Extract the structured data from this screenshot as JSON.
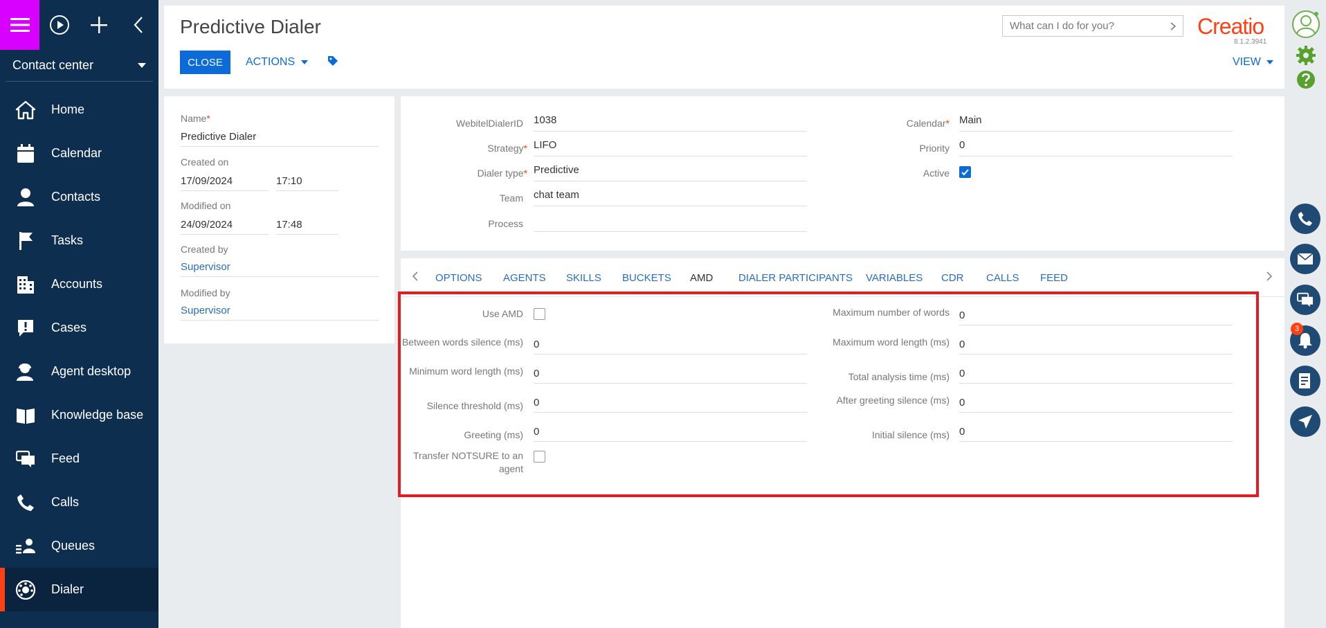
{
  "sidebar": {
    "workspace": "Contact center",
    "items": [
      {
        "label": "Home",
        "icon": "home-icon"
      },
      {
        "label": "Calendar",
        "icon": "calendar-icon"
      },
      {
        "label": "Contacts",
        "icon": "contact-icon"
      },
      {
        "label": "Tasks",
        "icon": "flag-icon"
      },
      {
        "label": "Accounts",
        "icon": "building-icon"
      },
      {
        "label": "Cases",
        "icon": "case-icon"
      },
      {
        "label": "Agent desktop",
        "icon": "agent-icon"
      },
      {
        "label": "Knowledge base",
        "icon": "book-icon"
      },
      {
        "label": "Feed",
        "icon": "chat-icon"
      },
      {
        "label": "Calls",
        "icon": "phone-icon"
      },
      {
        "label": "Queues",
        "icon": "queue-icon"
      },
      {
        "label": "Dialer",
        "icon": "dialer-icon",
        "active": true
      }
    ]
  },
  "header": {
    "title": "Predictive Dialer",
    "close_label": "CLOSE",
    "actions_label": "ACTIONS",
    "search_placeholder": "What can I do for you?",
    "logo": "Creatio",
    "version": "8.1.2.3941",
    "view_label": "VIEW"
  },
  "info": {
    "name_label": "Name",
    "name_value": "Predictive Dialer",
    "created_on_label": "Created on",
    "created_date": "17/09/2024",
    "created_time": "17:10",
    "modified_on_label": "Modified on",
    "modified_date": "24/09/2024",
    "modified_time": "17:48",
    "created_by_label": "Created by",
    "created_by": "Supervisor",
    "modified_by_label": "Modified by",
    "modified_by": "Supervisor"
  },
  "fields": {
    "webitel_label": "WebitelDialerID",
    "webitel_value": "1038",
    "strategy_label": "Strategy",
    "strategy_value": "LIFO",
    "dialer_type_label": "Dialer type",
    "dialer_type_value": "Predictive",
    "team_label": "Team",
    "team_value": "chat  team",
    "process_label": "Process",
    "process_value": "",
    "calendar_label": "Calendar",
    "calendar_value": "Main",
    "priority_label": "Priority",
    "priority_value": "0",
    "active_label": "Active",
    "active_checked": true
  },
  "tabs": [
    "OPTIONS",
    "AGENTS",
    "SKILLS",
    "BUCKETS",
    "AMD",
    "DIALER PARTICIPANTS",
    "VARIABLES",
    "CDR",
    "CALLS",
    "FEED"
  ],
  "active_tab": "AMD",
  "amd": {
    "use_amd_label": "Use AMD",
    "use_amd_checked": false,
    "between_words_label": "Between words silence (ms)",
    "between_words_value": "0",
    "min_word_length_label": "Minimum word length (ms)",
    "min_word_length_value": "0",
    "silence_threshold_label": "Silence threshold (ms)",
    "silence_threshold_value": "0",
    "greeting_label": "Greeting (ms)",
    "greeting_value": "0",
    "transfer_label": "Transfer NOTSURE to an agent",
    "transfer_checked": false,
    "max_words_label": "Maximum number of words",
    "max_words_value": "0",
    "max_word_length_label": "Maximum word length (ms)",
    "max_word_length_value": "0",
    "total_analysis_label": "Total analysis time (ms)",
    "total_analysis_value": "0",
    "after_greeting_label": "After greeting silence (ms)",
    "after_greeting_value": "0",
    "initial_silence_label": "Initial silence (ms)",
    "initial_silence_value": "0"
  },
  "rail": {
    "notification_count": "3"
  },
  "colors": {
    "sidebar": "#0d2e4e",
    "menu_button": "#d800ff",
    "accent": "#0c6bd8",
    "brand": "#ff4013",
    "highlight": "#e31b23"
  }
}
